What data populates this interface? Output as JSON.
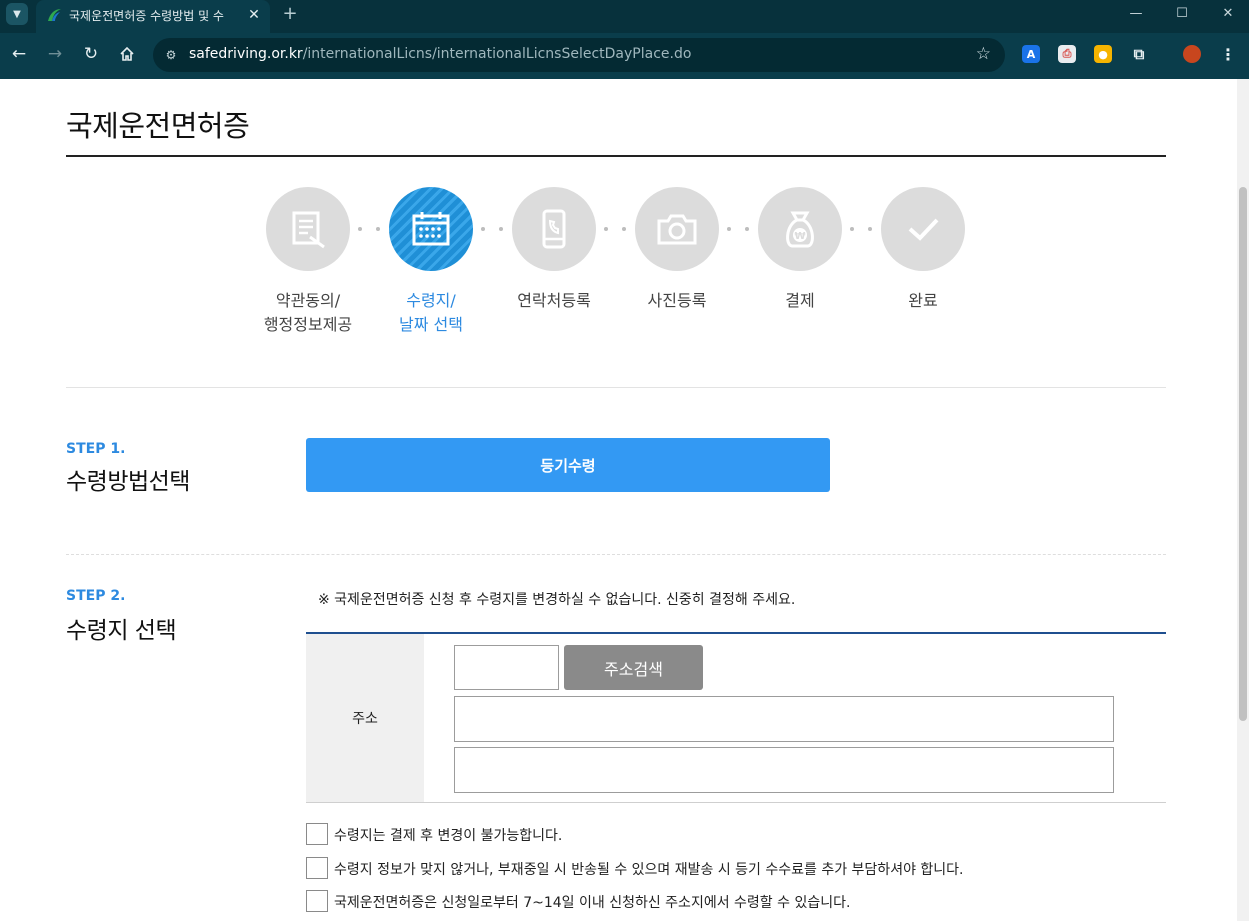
{
  "browser": {
    "tab_title": "국제운전면허증 수령방법 및 수",
    "url_host": "safedriving.or.kr",
    "url_path": "/internationalLicns/internationalLicnsSelectDayPlace.do",
    "extensions": [
      {
        "icon": "translate-extension-icon",
        "label": "A",
        "color": "#1a73e8"
      },
      {
        "icon": "printer-extension-icon",
        "label": "",
        "color": "#d9534f"
      },
      {
        "icon": "note-extension-icon",
        "label": "",
        "color": "#f6b400"
      },
      {
        "icon": "puzzle-extensions-icon",
        "label": "",
        "color": "#ffffff"
      }
    ]
  },
  "page": {
    "title": "국제운전면허증"
  },
  "stepper": {
    "active_color": "#2d8ae0",
    "steps": [
      {
        "icon": "document-pen-icon",
        "label": "약관동의/\n행정정보제공",
        "active": false
      },
      {
        "icon": "calendar-icon",
        "label": "수령지/\n날짜 선택",
        "active": true
      },
      {
        "icon": "phone-icon",
        "label": "연락처등록",
        "active": false
      },
      {
        "icon": "camera-icon",
        "label": "사진등록",
        "active": false
      },
      {
        "icon": "money-bag-won-icon",
        "label": "결제",
        "active": false
      },
      {
        "icon": "checkmark-icon",
        "label": "완료",
        "active": false
      }
    ]
  },
  "step1": {
    "tag": "STEP 1.",
    "heading": "수령방법선택",
    "method_button": "등기수령"
  },
  "step2": {
    "tag": "STEP 2.",
    "heading": "수령지 선택",
    "notice": "※ 국제운전면허증 신청 후 수령지를 변경하실 수 없습니다. 신중히 결정해 주세요.",
    "address_label": "주소",
    "zip_value": "",
    "search_button": "주소검색",
    "address1_value": "",
    "address2_value": "",
    "agreements": [
      "수령지는 결제 후 변경이 불가능합니다.",
      "수령지 정보가 맞지 않거나, 부재중일 시 반송될 수 있으며 재발송 시 등기 수수료를 추가 부담하셔야 합니다.",
      "국제운전면허증은 신청일로부터 7~14일 이내 신청하신 주소지에서 수령할 수 있습니다."
    ]
  }
}
